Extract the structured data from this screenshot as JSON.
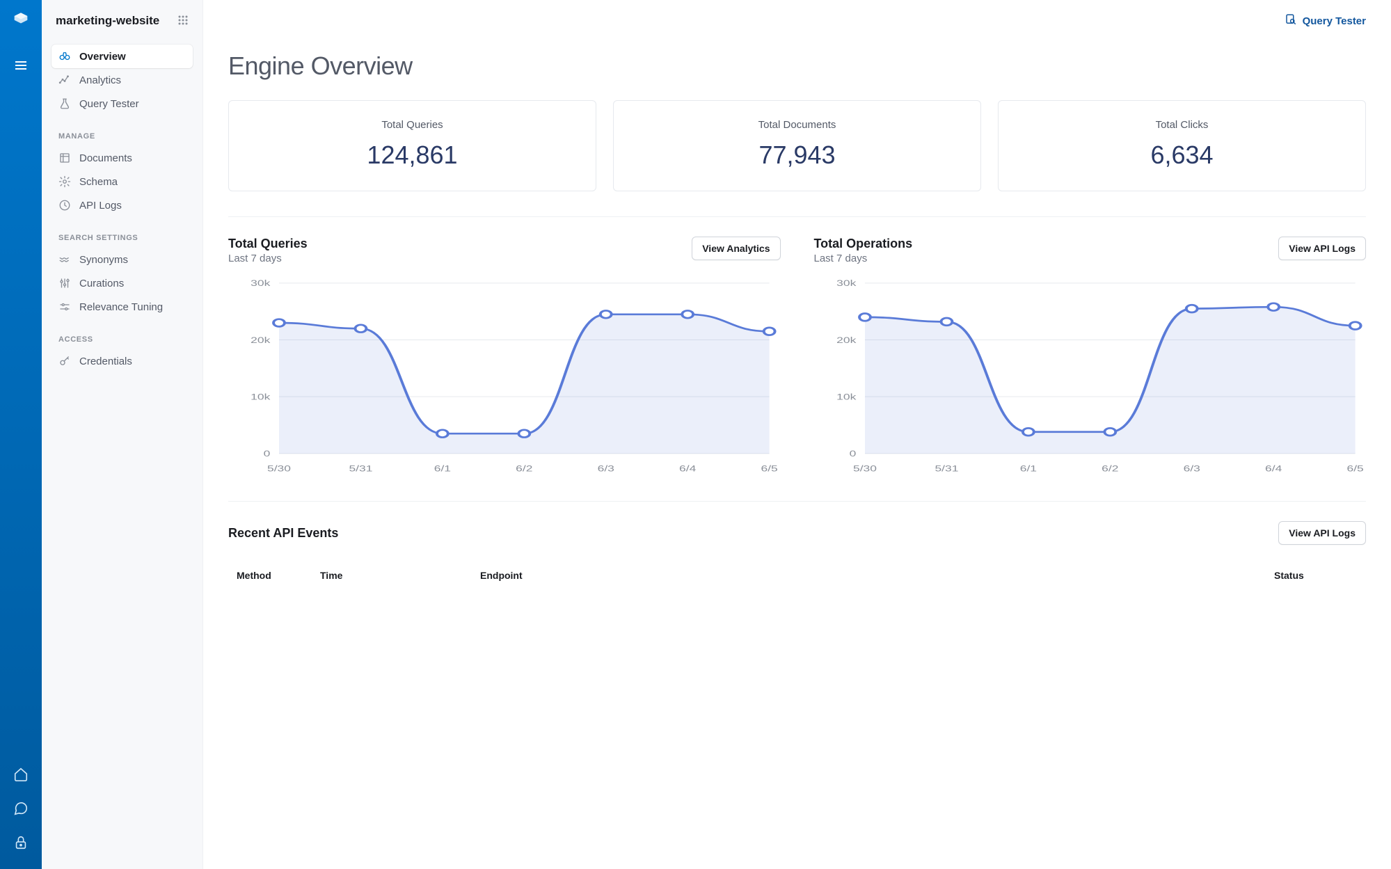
{
  "sidebar": {
    "title": "marketing-website",
    "nav_primary": [
      {
        "label": "Overview",
        "icon": "binoculars",
        "active": true
      },
      {
        "label": "Analytics",
        "icon": "analytics",
        "active": false
      },
      {
        "label": "Query Tester",
        "icon": "flask",
        "active": false
      }
    ],
    "groups": [
      {
        "heading": "MANAGE",
        "items": [
          {
            "label": "Documents",
            "icon": "documents"
          },
          {
            "label": "Schema",
            "icon": "gear"
          },
          {
            "label": "API Logs",
            "icon": "clock"
          }
        ]
      },
      {
        "heading": "SEARCH SETTINGS",
        "items": [
          {
            "label": "Synonyms",
            "icon": "waves"
          },
          {
            "label": "Curations",
            "icon": "sliders"
          },
          {
            "label": "Relevance Tuning",
            "icon": "tuning"
          }
        ]
      },
      {
        "heading": "ACCESS",
        "items": [
          {
            "label": "Credentials",
            "icon": "key"
          }
        ]
      }
    ]
  },
  "topbar": {
    "query_tester_label": "Query Tester"
  },
  "page": {
    "title": "Engine Overview",
    "stats": [
      {
        "label": "Total Queries",
        "value": "124,861"
      },
      {
        "label": "Total Documents",
        "value": "77,943"
      },
      {
        "label": "Total Clicks",
        "value": "6,634"
      }
    ],
    "charts": [
      {
        "title": "Total Queries",
        "sub": "Last 7 days",
        "button": "View Analytics"
      },
      {
        "title": "Total Operations",
        "sub": "Last 7 days",
        "button": "View API Logs"
      }
    ],
    "recent": {
      "title": "Recent API Events",
      "button": "View API Logs",
      "columns": [
        "Method",
        "Time",
        "Endpoint",
        "Status"
      ]
    }
  },
  "chart_data": [
    {
      "type": "line",
      "title": "Total Queries",
      "subtitle": "Last 7 days",
      "xlabel": "",
      "ylabel": "",
      "categories": [
        "5/30",
        "5/31",
        "6/1",
        "6/2",
        "6/3",
        "6/4",
        "6/5"
      ],
      "values": [
        23000,
        22000,
        3500,
        3500,
        24500,
        24500,
        21500
      ],
      "ylim": [
        0,
        30000
      ],
      "yticks": [
        0,
        10000,
        20000,
        30000
      ],
      "ytick_labels": [
        "0",
        "10k",
        "20k",
        "30k"
      ]
    },
    {
      "type": "line",
      "title": "Total Operations",
      "subtitle": "Last 7 days",
      "xlabel": "",
      "ylabel": "",
      "categories": [
        "5/30",
        "5/31",
        "6/1",
        "6/2",
        "6/3",
        "6/4",
        "6/5"
      ],
      "values": [
        24000,
        23200,
        3800,
        3800,
        25500,
        25800,
        22500
      ],
      "ylim": [
        0,
        30000
      ],
      "yticks": [
        0,
        10000,
        20000,
        30000
      ],
      "ytick_labels": [
        "0",
        "10k",
        "20k",
        "30k"
      ]
    }
  ]
}
